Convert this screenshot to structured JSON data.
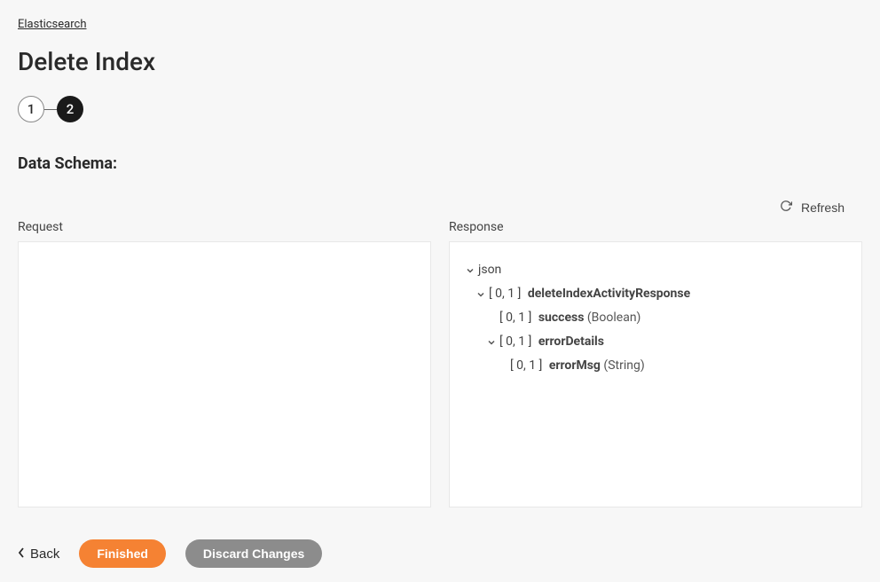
{
  "breadcrumb": {
    "root": "Elasticsearch"
  },
  "page_title": "Delete Index",
  "stepper": {
    "step1": "1",
    "step2": "2"
  },
  "section_title": "Data Schema:",
  "refresh_label": "Refresh",
  "panels": {
    "request_label": "Request",
    "response_label": "Response"
  },
  "response_tree": {
    "root": "json",
    "node1_range": "[ 0, 1 ]",
    "node1_name": "deleteIndexActivityResponse",
    "node2_range": "[ 0, 1 ]",
    "node2_name": "success",
    "node2_type": "(Boolean)",
    "node3_range": "[ 0, 1 ]",
    "node3_name": "errorDetails",
    "node4_range": "[ 0, 1 ]",
    "node4_name": "errorMsg",
    "node4_type": "(String)"
  },
  "actions": {
    "back": "Back",
    "finished": "Finished",
    "discard": "Discard Changes"
  }
}
